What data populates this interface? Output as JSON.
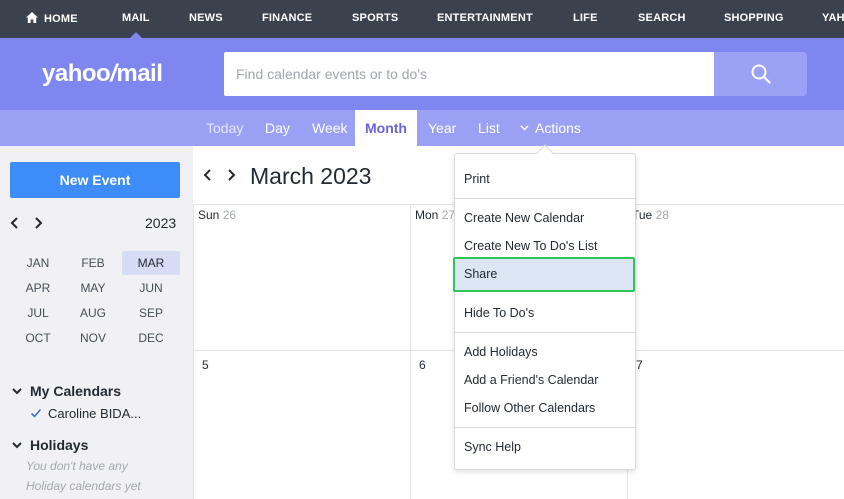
{
  "topnav": {
    "items": [
      "HOME",
      "MAIL",
      "NEWS",
      "FINANCE",
      "SPORTS",
      "ENTERTAINMENT",
      "LIFE",
      "SEARCH",
      "SHOPPING",
      "YAH"
    ],
    "active": "MAIL"
  },
  "header": {
    "logo_pre": "yahoo",
    "logo_slash": "/",
    "logo_post": "mail",
    "search_placeholder": "Find calendar events or to do's"
  },
  "viewbar": {
    "tabs": [
      "Today",
      "Day",
      "Week",
      "Month",
      "Year",
      "List"
    ],
    "active": "Month",
    "actions": "Actions"
  },
  "sidebar": {
    "new_event": "New Event",
    "year": "2023",
    "months": [
      "JAN",
      "FEB",
      "MAR",
      "APR",
      "MAY",
      "JUN",
      "JUL",
      "AUG",
      "SEP",
      "OCT",
      "NOV",
      "DEC"
    ],
    "selected_month": "MAR",
    "my_calendars": "My Calendars",
    "calendar_item": "Caroline BIDA...",
    "holidays": "Holidays",
    "holidays_empty_1": "You don't have any",
    "holidays_empty_2": "Holiday calendars yet"
  },
  "calendar": {
    "title": "March 2023",
    "day_heads": [
      {
        "name": "Sun",
        "num": "26"
      },
      {
        "name": "Mon",
        "num": "27"
      },
      {
        "name": "Tue",
        "num": "28"
      }
    ],
    "row2_nums": [
      "5",
      "6",
      "7"
    ]
  },
  "actions_menu": {
    "items": [
      "Print",
      "Create New Calendar",
      "Create New To Do's List",
      "Share",
      "Hide To Do's",
      "Add Holidays",
      "Add a Friend's Calendar",
      "Follow Other Calendars",
      "Sync Help"
    ],
    "highlighted": "Share"
  },
  "colors": {
    "topnav_bg": "#39424d",
    "brand_purple": "#7e86f0",
    "viewbar_bg": "#9aa1f5",
    "new_event_blue": "#3d8cf7",
    "highlight_border": "#2fc55a"
  }
}
